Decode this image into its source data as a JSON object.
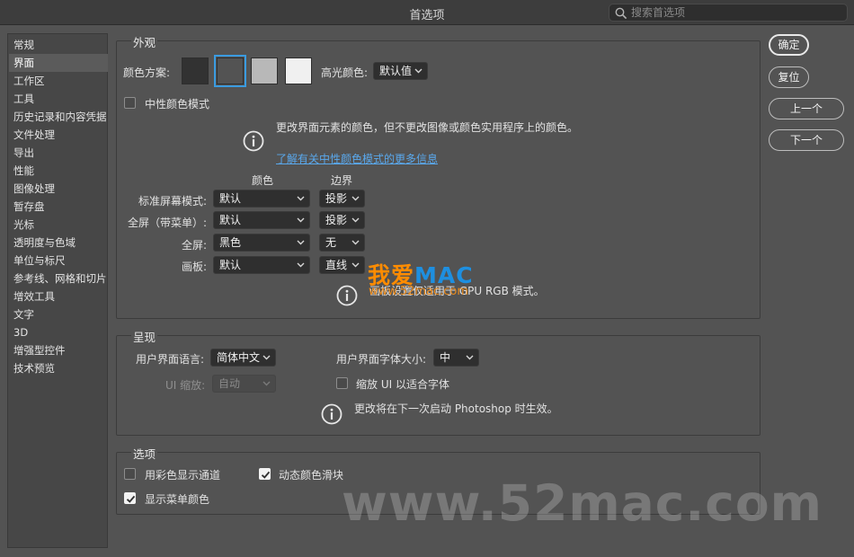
{
  "window": {
    "title": "首选项",
    "search_placeholder": "搜索首选项"
  },
  "sidebar": {
    "items": [
      "常规",
      "界面",
      "工作区",
      "工具",
      "历史记录和内容凭据",
      "文件处理",
      "导出",
      "性能",
      "图像处理",
      "暂存盘",
      "光标",
      "透明度与色域",
      "单位与标尺",
      "参考线、网格和切片",
      "增效工具",
      "文字",
      "3D",
      "增强型控件",
      "技术预览"
    ],
    "selected": "界面"
  },
  "appearance": {
    "title": "外观",
    "color_scheme_label": "颜色方案:",
    "swatch_colors": [
      "#323232",
      "#535353",
      "#b8b8b8",
      "#f0f0f0"
    ],
    "selected_swatch": 1,
    "highlight_label": "高光颜色:",
    "highlight_value": "默认值",
    "neutral_mode_label": "中性颜色模式",
    "neutral_mode_checked": false,
    "info_text": "更改界面元素的颜色，但不更改图像或颜色实用程序上的颜色。",
    "info_link": "了解有关中性颜色模式的更多信息",
    "col_color": "颜色",
    "col_border": "边界",
    "rows": [
      {
        "label": "标准屏幕模式:",
        "color": "默认",
        "border": "投影"
      },
      {
        "label": "全屏（带菜单）:",
        "color": "默认",
        "border": "投影"
      },
      {
        "label": "全屏:",
        "color": "黑色",
        "border": "无"
      },
      {
        "label": "画板:",
        "color": "默认",
        "border": "直线"
      }
    ],
    "artboard_note": "画板设置仅适用于 GPU RGB 模式。"
  },
  "presentation": {
    "title": "呈现",
    "lang_label": "用户界面语言:",
    "lang_value": "简体中文",
    "font_size_label": "用户界面字体大小:",
    "font_size_value": "中",
    "ui_scale_label": "UI 缩放:",
    "ui_scale_value": "自动",
    "scale_font_label": "缩放 UI 以适合字体",
    "scale_font_checked": false,
    "restart_note": "更改将在下一次启动 Photoshop 时生效。"
  },
  "options": {
    "title": "选项",
    "color_channels_label": "用彩色显示通道",
    "color_channels_checked": false,
    "dynamic_sliders_label": "动态颜色滑块",
    "dynamic_sliders_checked": true,
    "menu_colors_label": "显示菜单颜色",
    "menu_colors_checked": true
  },
  "buttons": {
    "ok": "确定",
    "reset": "复位",
    "prev": "上一个",
    "next": "下一个"
  },
  "watermark": {
    "brand_cn": "我爱",
    "brand_en": "MAC",
    "site_small": "www.52mac.com",
    "site_large": "www.52mac.com"
  },
  "icons": [
    "search-icon",
    "info-icon",
    "chevron-down-icon",
    "checkmark-icon"
  ]
}
